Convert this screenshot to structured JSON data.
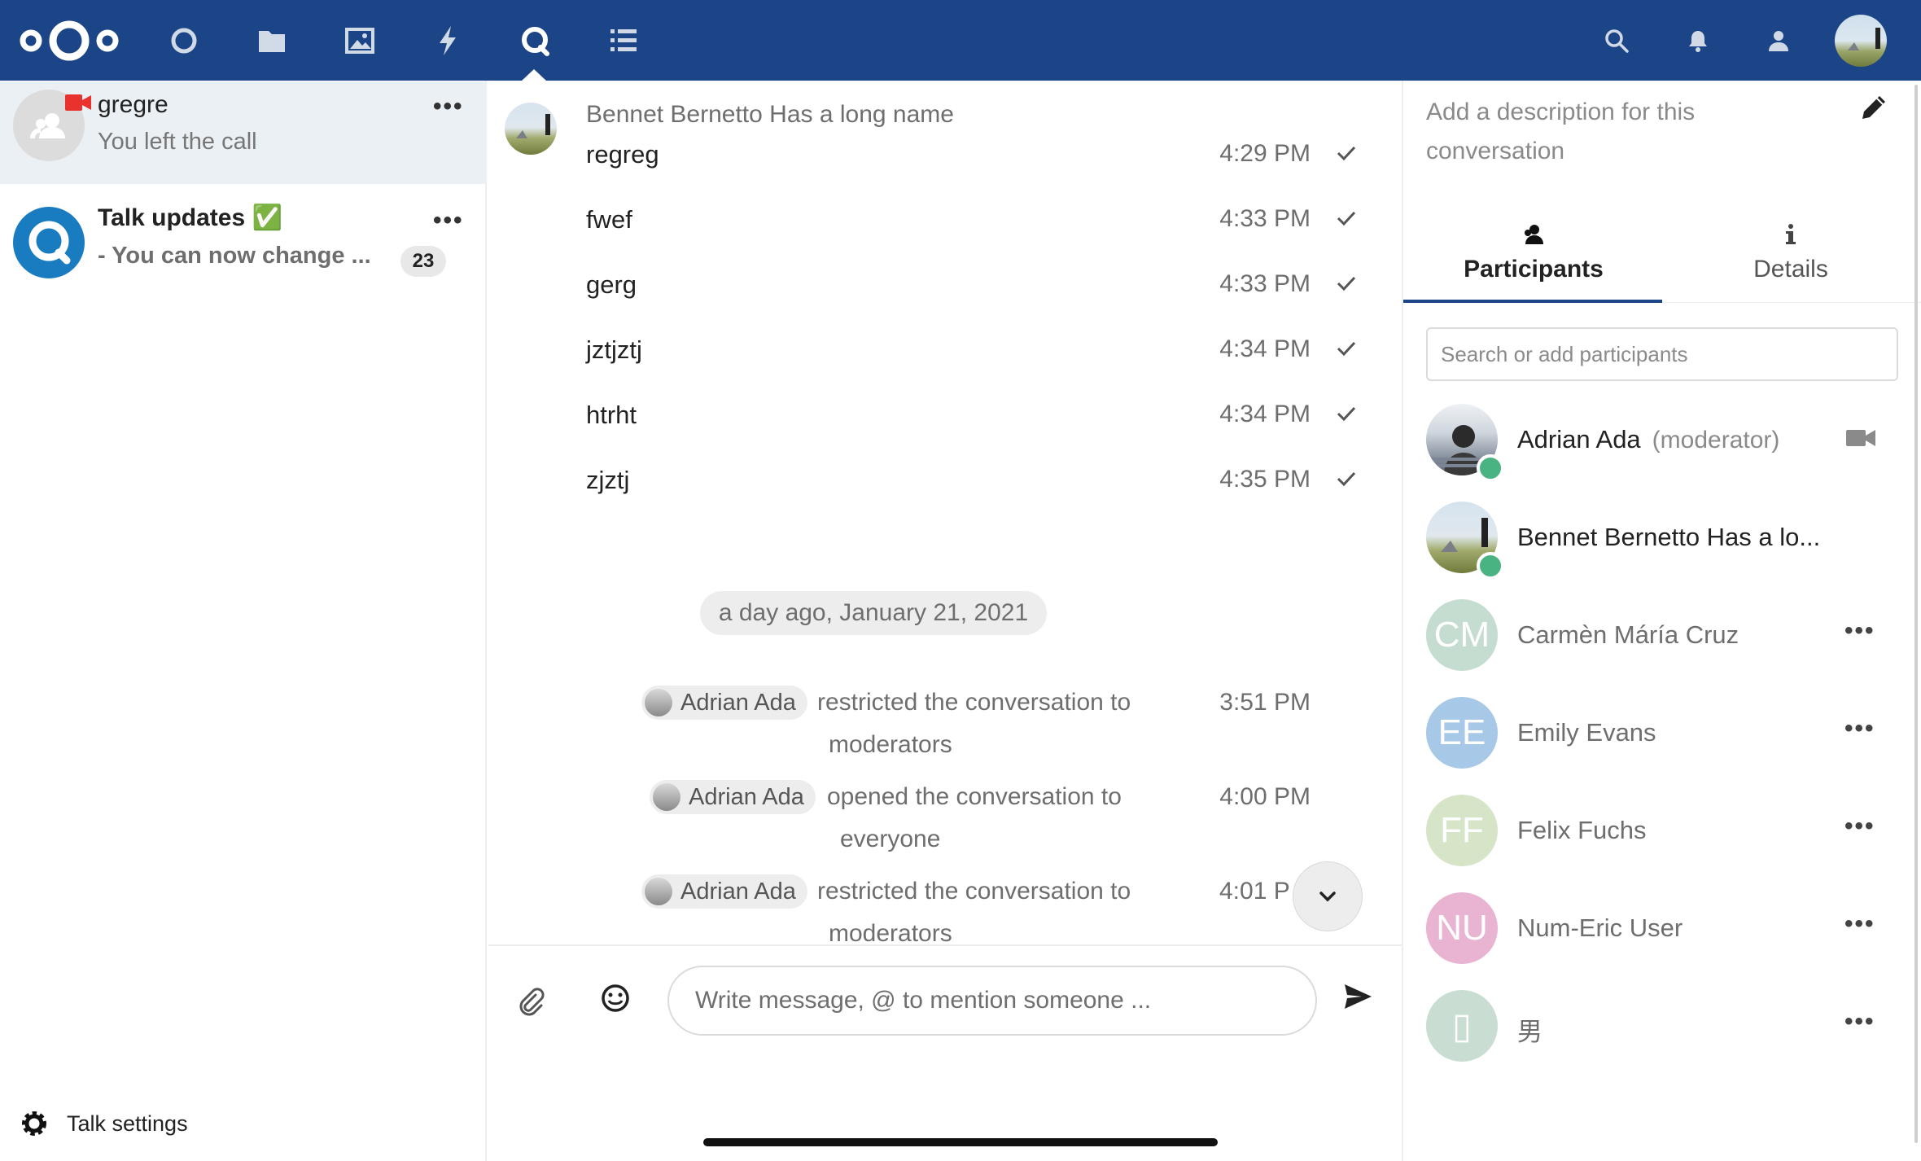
{
  "header": {
    "apps": [
      {
        "name": "dashboard-icon"
      },
      {
        "name": "files-icon"
      },
      {
        "name": "photos-icon"
      },
      {
        "name": "activity-icon"
      },
      {
        "name": "talk-icon",
        "active": true
      },
      {
        "name": "tasks-icon"
      }
    ],
    "right_icons": [
      "search-icon",
      "bell-icon",
      "contacts-icon"
    ],
    "accent": "#1c4587"
  },
  "sidebar": {
    "conversations": [
      {
        "title": "gregre",
        "subtitle": "You left the call",
        "active": true,
        "in_call_icon": "video-camera-icon"
      },
      {
        "title": "Talk updates ✅",
        "subtitle": "- You can now change ...",
        "unread": "23"
      }
    ],
    "settings_label": "Talk settings"
  },
  "chat": {
    "author": "Bennet Bernetto Has a long name",
    "messages": [
      {
        "text": "regreg",
        "time": "4:29 PM"
      },
      {
        "text": "fwef",
        "time": "4:33 PM"
      },
      {
        "text": "gerg",
        "time": "4:33 PM"
      },
      {
        "text": "jztjztj",
        "time": "4:34 PM"
      },
      {
        "text": "htrht",
        "time": "4:34 PM"
      },
      {
        "text": "zjztj",
        "time": "4:35 PM"
      }
    ],
    "date_separator": "a day ago, January 21, 2021",
    "system_messages": [
      {
        "actor": "Adrian Ada",
        "line1": "restricted the conversation to",
        "line2": "moderators",
        "time": "3:51 PM"
      },
      {
        "actor": "Adrian Ada",
        "line1": "opened the conversation to",
        "line2": "everyone",
        "time": "4:00 PM"
      },
      {
        "actor": "Adrian Ada",
        "line1": "restricted the conversation to",
        "line2": "moderators",
        "time": "4:01 P"
      }
    ],
    "composer_placeholder": "Write message, @ to mention someone ..."
  },
  "details": {
    "description_placeholder": "Add a description for this conversation",
    "tabs": [
      {
        "label": "Participants",
        "icon": "participants-icon",
        "active": true
      },
      {
        "label": "Details",
        "icon": "info-icon"
      }
    ],
    "search_placeholder": "Search or add participants",
    "participants": [
      {
        "name": "Adrian Ada",
        "role": "(moderator)",
        "online": true,
        "in_call": true
      },
      {
        "name": "Bennet Bernetto Has a lo...",
        "online": true
      },
      {
        "name": "Carmèn Máría Cruz",
        "initials": "CM",
        "color": "#c5ddd0"
      },
      {
        "name": "Emily Evans",
        "initials": "EE",
        "color": "#a8c8e8"
      },
      {
        "name": "Felix Fuchs",
        "initials": "FF",
        "color": "#d6e4c8"
      },
      {
        "name": "Num-Eric User",
        "initials": "NU",
        "color": "#e8b4d2"
      },
      {
        "name": "男",
        "initials": "▯",
        "color": "#c9ddd2"
      }
    ]
  }
}
